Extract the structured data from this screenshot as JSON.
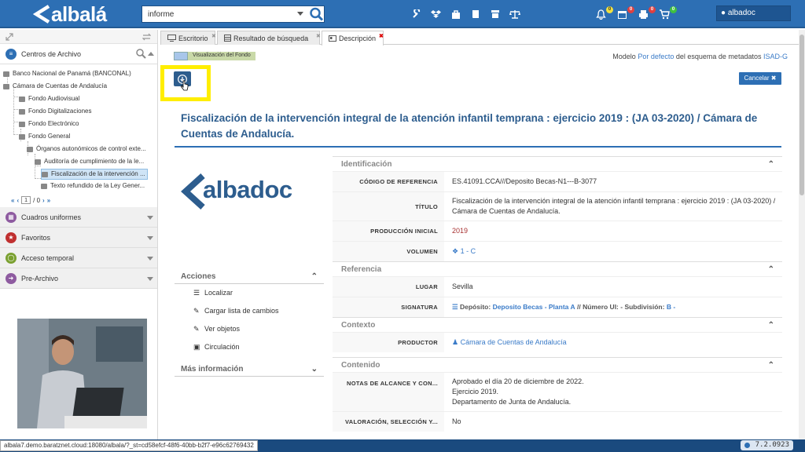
{
  "app": {
    "brand": "albalá",
    "accent": "#2d6fb4"
  },
  "search": {
    "value": "informe"
  },
  "toolbar_icons": [
    "wrench-icon",
    "dropbox-icon",
    "bag-icon",
    "book-icon",
    "archive-box-icon",
    "scales-icon"
  ],
  "notifications": [
    {
      "icon": "bell-icon",
      "count": "0",
      "color": "#f0e040"
    },
    {
      "icon": "calendar-icon",
      "count": "0",
      "color": "#e04040"
    },
    {
      "icon": "print-icon",
      "count": "0",
      "color": "#e04040"
    },
    {
      "icon": "cart-icon",
      "count": "0",
      "color": "#40c040"
    }
  ],
  "user": {
    "name": "albadoc"
  },
  "sidebar": {
    "centros": "Centros de Archivo",
    "tree": [
      {
        "label": "Banco Nacional de Panamá (BANCONAL)"
      },
      {
        "label": "Cámara de Cuentas de Andalucía"
      },
      {
        "label": "Fondo Audiovisual"
      },
      {
        "label": "Fondo Digitalizaciones"
      },
      {
        "label": "Fondo Electrónico"
      },
      {
        "label": "Fondo General"
      },
      {
        "label": "Órganos autonómicos de control exte..."
      },
      {
        "label": "Auditoría de cumplimiento de la le..."
      },
      {
        "label": "Fiscalización de la intervención ..."
      },
      {
        "label": "Texto refundido de la Ley Gener..."
      }
    ],
    "pager": {
      "page": "1",
      "total": "/ 0"
    },
    "sections": [
      "Cuadros uniformes",
      "Favoritos",
      "Acceso temporal",
      "Pre-Archivo"
    ]
  },
  "tabs": [
    {
      "label": "Escritorio"
    },
    {
      "label": "Resultado de búsqueda"
    },
    {
      "label": "Descripción"
    }
  ],
  "header": {
    "badge": "Visualización del Fondo",
    "modelo_prefix": "Modelo",
    "modelo_link": "Por defecto",
    "modelo_mid": "del esquema de metadatos",
    "modelo_schema": "ISAD-G",
    "cancel": "Cancelar"
  },
  "title": "Fiscalización de la intervención integral de la atención infantil temprana : ejercicio 2019 : (JA 03-2020) / Cámara de Cuentas de Andalucía.",
  "logo_text": "albadoc",
  "actions": {
    "heading": "Acciones",
    "items": [
      "Localizar",
      "Cargar lista de cambios",
      "Ver objetos",
      "Circulación"
    ],
    "more": "Más información"
  },
  "metadata": {
    "identificacion": {
      "heading": "Identificación",
      "codigo_k": "CÓDIGO DE REFERENCIA",
      "codigo_v": "ES.41091.CCA///Deposito Becas-N1---B-3077",
      "titulo_k": "TÍTULO",
      "titulo_v": "Fiscalización de la intervención integral de la atención infantil temprana : ejercicio 2019 : (JA 03-2020) / Cámara de Cuentas de Andalucía.",
      "produccion_k": "PRODUCCIÓN INICIAL",
      "produccion_v": "2019",
      "volumen_k": "VOLUMEN",
      "volumen_v": "1 - C"
    },
    "referencia": {
      "heading": "Referencia",
      "lugar_k": "LUGAR",
      "lugar_v": "Sevilla",
      "signatura_k": "SIGNATURA",
      "sig_deposito_label": "Depósito:",
      "sig_deposito_value": "Deposito Becas - Planta A",
      "sig_sep": "//",
      "sig_ui_label": "Número UI: - Subdivisión:",
      "sig_ui_value": "B -"
    },
    "contexto": {
      "heading": "Contexto",
      "productor_k": "PRODUCTOR",
      "productor_v": "Cámara de Cuentas de Andalucía"
    },
    "contenido": {
      "heading": "Contenido",
      "notas_k": "NOTAS DE ALCANCE Y CON...",
      "notas_v1": "Aprobado el día 20 de diciembre de 2022.",
      "notas_v2": "Ejercicio 2019.",
      "notas_v3": "Departamento de Junta de Andalucía.",
      "valoracion_k": "VALORACIÓN, SELECCIÓN Y...",
      "valoracion_v": "No"
    }
  },
  "status": {
    "url": "albala7.demo.baratznet.cloud:18080/albala/?_st=cd58efcf-48f6-40bb-b2f7-e96c62769432",
    "version": "7.2.0923"
  }
}
